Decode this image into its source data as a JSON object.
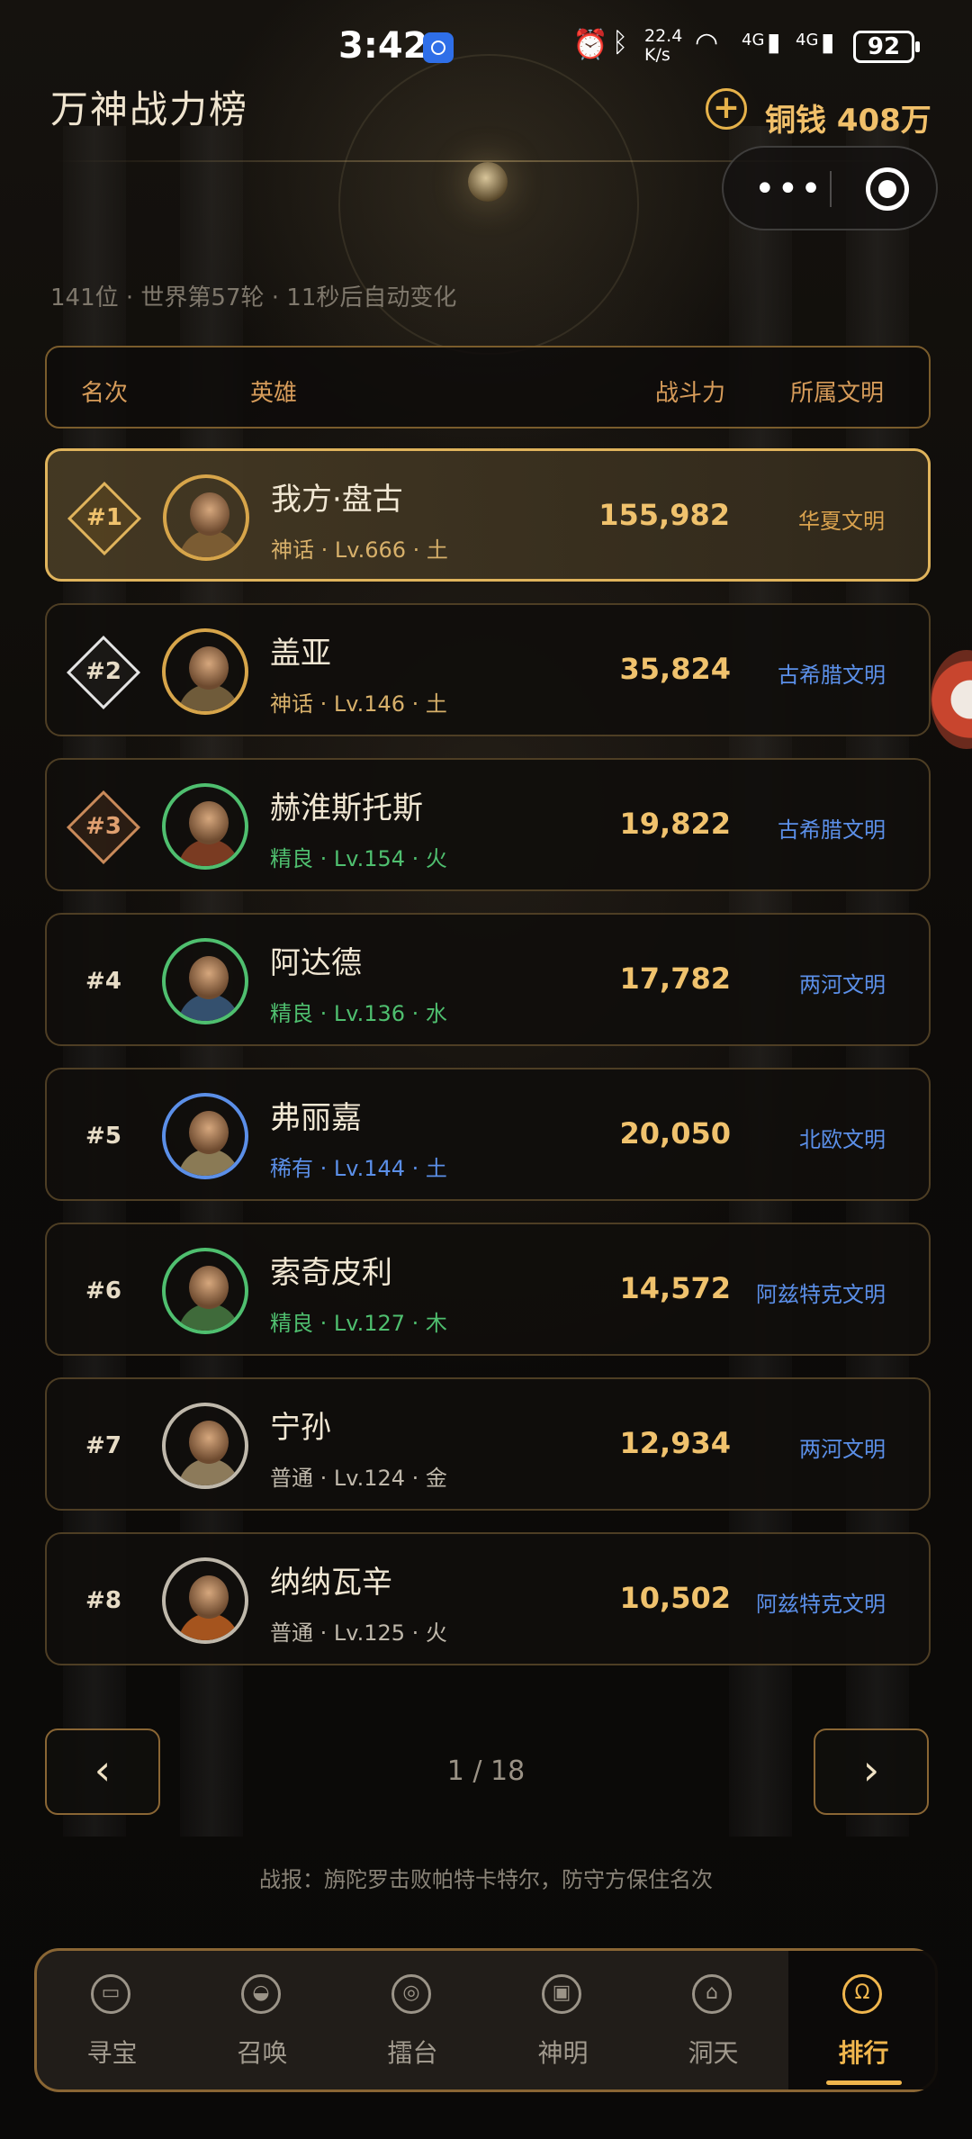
{
  "status_bar": {
    "time": "3:42",
    "net_speed": "22.4 K/s",
    "signal1": "4G",
    "signal2": "4G",
    "battery": "92"
  },
  "header": {
    "title": "万神战力榜",
    "coin_label": "铜钱 408万"
  },
  "info_line": "141位 · 世界第57轮 · 11秒后自动变化",
  "table": {
    "columns": [
      "名次",
      "英雄",
      "战斗力",
      "所属文明"
    ]
  },
  "colors": {
    "gold": "#f0c26d",
    "mythic_meta": "#d7b06a",
    "fine_meta": "#4fbf6f",
    "rare_meta": "#5b8fe8",
    "common_meta": "#bfb8ab",
    "civ_blue": "#5b8fe8",
    "civ_gold": "#d9a24e"
  },
  "rows": [
    {
      "rank": "#1",
      "name": "我方·盘古",
      "meta": "神话 · Lv.666 · 土",
      "power": "155,982",
      "civ": "华夏文明",
      "rarity": "mythic",
      "civ_color": "#d9a24e",
      "avatar_ring": "#d7a54a",
      "body_color": "#7b5c33"
    },
    {
      "rank": "#2",
      "name": "盖亚",
      "meta": "神话 · Lv.146 · 土",
      "power": "35,824",
      "civ": "古希腊文明",
      "rarity": "mythic",
      "civ_color": "#5b8fe8",
      "avatar_ring": "#d7a54a",
      "body_color": "#6f5b3a"
    },
    {
      "rank": "#3",
      "name": "赫淮斯托斯",
      "meta": "精良 · Lv.154 · 火",
      "power": "19,822",
      "civ": "古希腊文明",
      "rarity": "fine",
      "civ_color": "#5b8fe8",
      "avatar_ring": "#4fbf6f",
      "body_color": "#7a3b22"
    },
    {
      "rank": "#4",
      "name": "阿达德",
      "meta": "精良 · Lv.136 · 水",
      "power": "17,782",
      "civ": "两河文明",
      "rarity": "fine",
      "civ_color": "#5b8fe8",
      "avatar_ring": "#4fbf6f",
      "body_color": "#34506e"
    },
    {
      "rank": "#5",
      "name": "弗丽嘉",
      "meta": "稀有 · Lv.144 · 土",
      "power": "20,050",
      "civ": "北欧文明",
      "rarity": "rare",
      "civ_color": "#5b8fe8",
      "avatar_ring": "#5b8fe8",
      "body_color": "#8a7a55"
    },
    {
      "rank": "#6",
      "name": "索奇皮利",
      "meta": "精良 · Lv.127 · 木",
      "power": "14,572",
      "civ": "阿兹特克文明",
      "rarity": "fine",
      "civ_color": "#5b8fe8",
      "avatar_ring": "#4fbf6f",
      "body_color": "#3f6a3a"
    },
    {
      "rank": "#7",
      "name": "宁孙",
      "meta": "普通 · Lv.124 · 金",
      "power": "12,934",
      "civ": "两河文明",
      "rarity": "common",
      "civ_color": "#5b8fe8",
      "avatar_ring": "#bfb8ab",
      "body_color": "#8c7a5a"
    },
    {
      "rank": "#8",
      "name": "纳纳瓦辛",
      "meta": "普通 · Lv.125 · 火",
      "power": "10,502",
      "civ": "阿兹特克文明",
      "rarity": "common",
      "civ_color": "#5b8fe8",
      "avatar_ring": "#bfb8ab",
      "body_color": "#a5541e"
    }
  ],
  "pagination": {
    "prev": "‹",
    "next": "›",
    "indicator": "1 / 18"
  },
  "battle_report": "战报：旃陀罗击败帕特卡特尔，防守方保住名次",
  "nav": [
    {
      "label": "寻宝",
      "icon": "treasure-chest-icon",
      "glyph": "▭"
    },
    {
      "label": "召唤",
      "icon": "summon-icon",
      "glyph": "◒"
    },
    {
      "label": "擂台",
      "icon": "arena-icon",
      "glyph": "◎"
    },
    {
      "label": "神明",
      "icon": "deity-icon",
      "glyph": "▣"
    },
    {
      "label": "洞天",
      "icon": "grotto-house-icon",
      "glyph": "⌂"
    },
    {
      "label": "排行",
      "icon": "ranking-trophy-icon",
      "glyph": "Ω"
    }
  ]
}
